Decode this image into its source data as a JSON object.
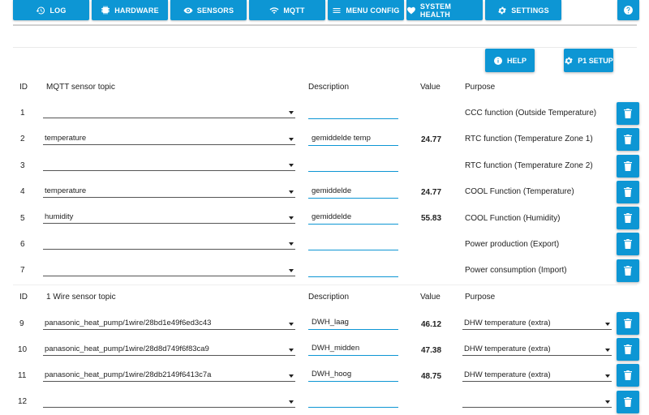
{
  "nav": {
    "items": [
      {
        "label": "LOG",
        "icon": "history-icon"
      },
      {
        "label": "HARDWARE",
        "icon": "chip-icon"
      },
      {
        "label": "SENSORS",
        "icon": "eye-icon"
      },
      {
        "label": "MQTT",
        "icon": "wifi-icon"
      },
      {
        "label": "MENU CONFIG",
        "icon": "menu-icon"
      },
      {
        "label": "SYSTEM HEALTH",
        "icon": "heart-icon"
      },
      {
        "label": "SETTINGS",
        "icon": "gear-icon"
      }
    ],
    "help_icon": "question-icon"
  },
  "actions": {
    "help_label": "HELP",
    "p1_label": "P1 SETUP"
  },
  "mqtt_table": {
    "headers": {
      "id": "ID",
      "topic": "MQTT sensor topic",
      "description": "Description",
      "value": "Value",
      "purpose": "Purpose"
    },
    "rows": [
      {
        "id": "1",
        "topic": "",
        "description": "",
        "value": "",
        "purpose": "CCC function (Outside Temperature)"
      },
      {
        "id": "2",
        "topic": "temperature",
        "description": "gemiddelde temp",
        "value": "24.77",
        "purpose": "RTC function (Temperature Zone 1)"
      },
      {
        "id": "3",
        "topic": "",
        "description": "",
        "value": "",
        "purpose": "RTC function (Temperature Zone 2)"
      },
      {
        "id": "4",
        "topic": "temperature",
        "description": "gemiddelde",
        "value": "24.77",
        "purpose": "COOL Function (Temperature)"
      },
      {
        "id": "5",
        "topic": "humidity",
        "description": "gemiddelde",
        "value": "55.83",
        "purpose": "COOL Function (Humidity)"
      },
      {
        "id": "6",
        "topic": "",
        "description": "",
        "value": "",
        "purpose": "Power production (Export)"
      },
      {
        "id": "7",
        "topic": "",
        "description": "",
        "value": "",
        "purpose": "Power consumption (Import)"
      }
    ]
  },
  "wire_table": {
    "headers": {
      "id": "ID",
      "topic": "1 Wire sensor topic",
      "description": "Description",
      "value": "Value",
      "purpose": "Purpose"
    },
    "rows": [
      {
        "id": "9",
        "topic": "panasonic_heat_pump/1wire/28bd1e49f6ed3c43",
        "description": "DWH_laag",
        "value": "46.12",
        "purpose": "DHW temperature (extra)"
      },
      {
        "id": "10",
        "topic": "panasonic_heat_pump/1wire/28d8d749f6f83ca9",
        "description": "DWH_midden",
        "value": "47.38",
        "purpose": "DHW temperature (extra)"
      },
      {
        "id": "11",
        "topic": "panasonic_heat_pump/1wire/28db2149f6413c7a",
        "description": "DWH_hoog",
        "value": "48.75",
        "purpose": "DHW temperature (extra)"
      },
      {
        "id": "12",
        "topic": "",
        "description": "",
        "value": "",
        "purpose": ""
      }
    ]
  },
  "colors": {
    "accent": "#0d96d4",
    "input_underline": "#0d96d4"
  }
}
